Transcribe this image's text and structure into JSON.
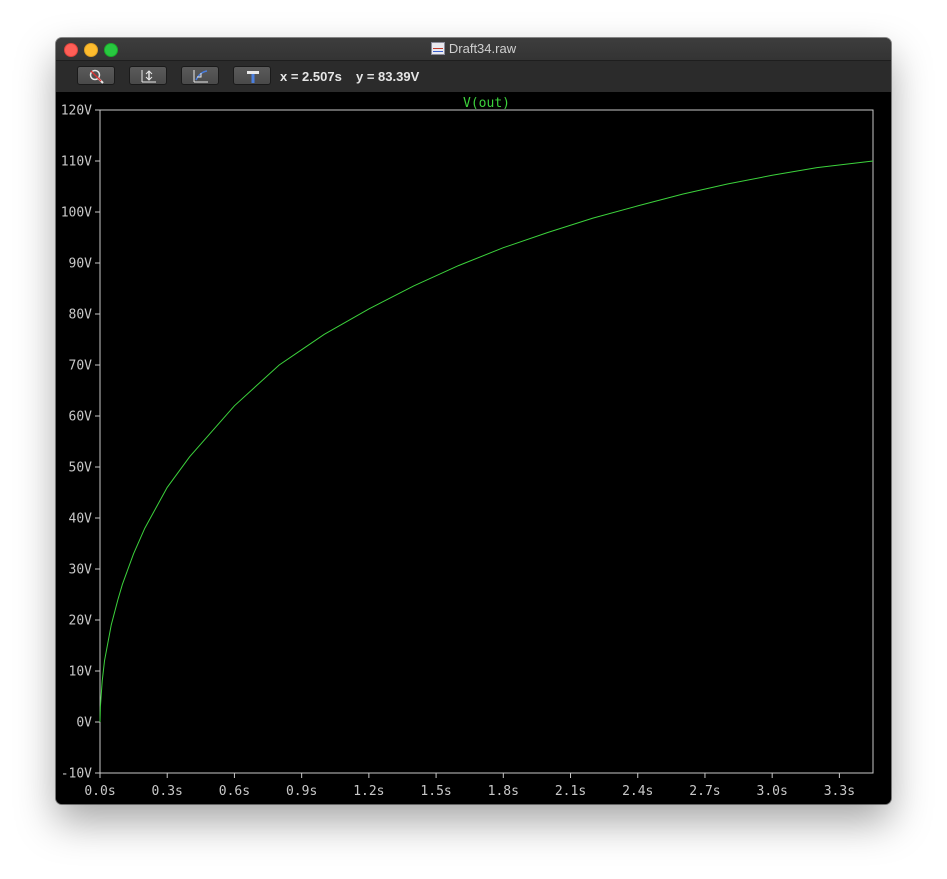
{
  "window": {
    "title": "Draft34.raw"
  },
  "toolbar": {
    "buttons": [
      {
        "icon": "zoom-magnifier-icon"
      },
      {
        "icon": "autorange-icon"
      },
      {
        "icon": "pan-icon"
      },
      {
        "icon": "probe-hammer-icon"
      }
    ],
    "cursor_x": "x = 2.507s",
    "cursor_y": "y = 83.39V"
  },
  "colors": {
    "trace": "#3cd23c",
    "axis": "#c8c8c8",
    "background": "#000000"
  },
  "chart_data": {
    "type": "line",
    "title": "V(out)",
    "xlabel": "",
    "ylabel": "",
    "xlim": [
      0,
      3.45
    ],
    "ylim": [
      -10,
      120
    ],
    "grid": false,
    "x_ticks": [
      "0.0s",
      "0.3s",
      "0.6s",
      "0.9s",
      "1.2s",
      "1.5s",
      "1.8s",
      "2.1s",
      "2.4s",
      "2.7s",
      "3.0s",
      "3.3s"
    ],
    "y_ticks": [
      "-10V",
      "0V",
      "10V",
      "20V",
      "30V",
      "40V",
      "50V",
      "60V",
      "70V",
      "80V",
      "90V",
      "100V",
      "110V",
      "120V"
    ],
    "series": [
      {
        "name": "V(out)",
        "x": [
          0,
          0.002,
          0.005,
          0.01,
          0.02,
          0.05,
          0.08,
          0.1,
          0.15,
          0.2,
          0.3,
          0.4,
          0.5,
          0.6,
          0.7,
          0.8,
          0.9,
          1.0,
          1.2,
          1.4,
          1.6,
          1.8,
          2.0,
          2.2,
          2.4,
          2.6,
          2.8,
          3.0,
          3.2,
          3.45
        ],
        "y": [
          0,
          3,
          5,
          8,
          12,
          19,
          24,
          27,
          33,
          38,
          46,
          52,
          57,
          62,
          66,
          70,
          73,
          76,
          81,
          85.5,
          89.5,
          93,
          96,
          98.8,
          101.2,
          103.5,
          105.5,
          107.2,
          108.7,
          110
        ]
      }
    ]
  }
}
